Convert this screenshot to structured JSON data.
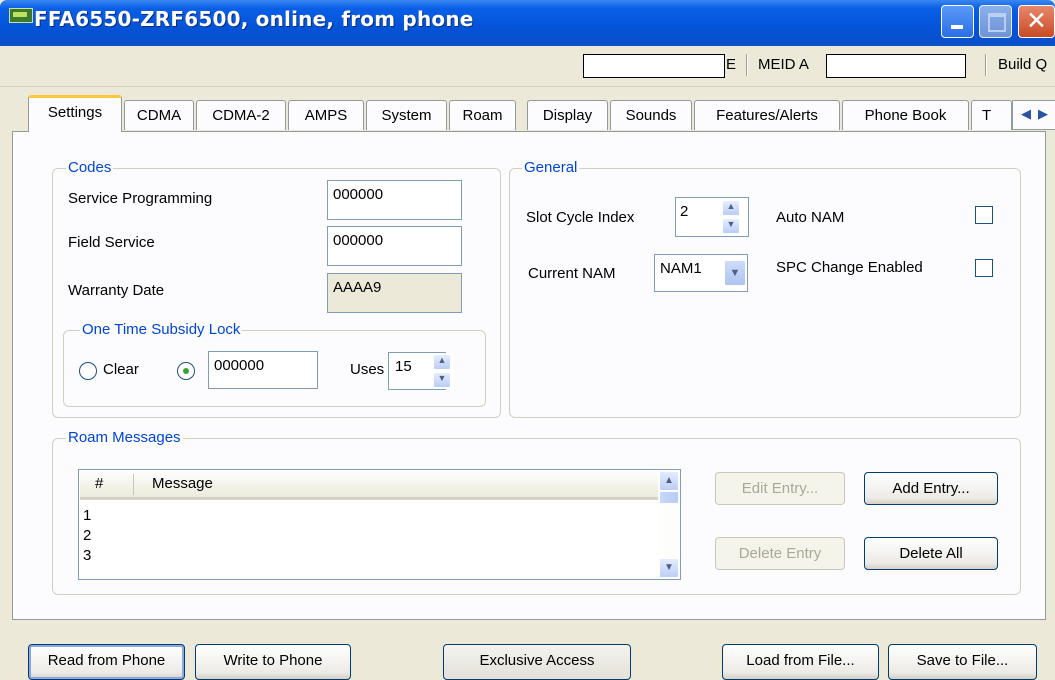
{
  "window": {
    "title": "FFA6550-ZRF6500, online, from phone",
    "minimize_icon": "minimize-icon",
    "maximize_icon": "maximize-icon",
    "close_icon": "close-icon"
  },
  "status_bar": {
    "esn_fragment": "E",
    "meid_label": "MEID A",
    "build_label": "Build Q"
  },
  "tabs": [
    {
      "label": "Settings",
      "active": true
    },
    {
      "label": "CDMA"
    },
    {
      "label": "CDMA-2"
    },
    {
      "label": "AMPS"
    },
    {
      "label": "System"
    },
    {
      "label": "Roam"
    },
    {
      "label": "Display"
    },
    {
      "label": "Sounds"
    },
    {
      "label": "Features/Alerts"
    },
    {
      "label": "Phone Book"
    },
    {
      "label": "T"
    }
  ],
  "codes": {
    "legend": "Codes",
    "service_programming_label": "Service Programming",
    "service_programming_value": "000000",
    "field_service_label": "Field Service",
    "field_service_value": "000000",
    "warranty_date_label": "Warranty Date",
    "warranty_date_value": "AAAA9"
  },
  "subsidy_lock": {
    "legend": "One Time Subsidy Lock",
    "clear_label": "Clear",
    "code_value": "000000",
    "uses_label": "Uses",
    "uses_value": "15"
  },
  "general": {
    "legend": "General",
    "slot_cycle_label": "Slot Cycle Index",
    "slot_cycle_value": "2",
    "current_nam_label": "Current NAM",
    "current_nam_value": "NAM1",
    "auto_nam_label": "Auto NAM",
    "auto_nam_checked": false,
    "spc_change_label": "SPC Change Enabled",
    "spc_change_checked": false
  },
  "roam_messages": {
    "legend": "Roam Messages",
    "columns": [
      "#",
      "Message"
    ],
    "rows": [
      "1",
      "2",
      "3"
    ],
    "edit_entry_label": "Edit Entry...",
    "add_entry_label": "Add Entry...",
    "delete_entry_label": "Delete Entry",
    "delete_all_label": "Delete All"
  },
  "footer": {
    "read_label": "Read from Phone",
    "write_label": "Write to Phone",
    "exclusive_label": "Exclusive Access",
    "load_label": "Load from File...",
    "save_label": "Save to File..."
  }
}
